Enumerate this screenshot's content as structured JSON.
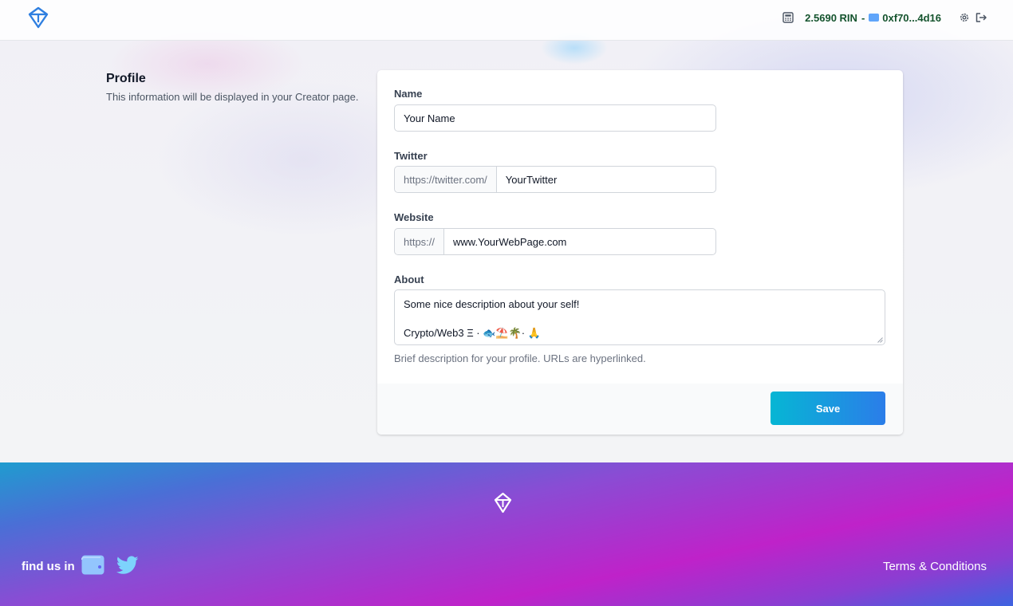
{
  "header": {
    "balance": "2.5690 RIN",
    "separator": "-",
    "address": "0xf70...4d16",
    "icons": [
      "calculator-icon",
      "wallet-chip-icon",
      "gear-icon",
      "logout-icon"
    ]
  },
  "intro": {
    "title": "Profile",
    "description": "This information will be displayed in your Creator page."
  },
  "form": {
    "name": {
      "label": "Name",
      "value": "Your Name"
    },
    "twitter": {
      "label": "Twitter",
      "prefix": "https://twitter.com/",
      "value": "YourTwitter"
    },
    "website": {
      "label": "Website",
      "prefix": "https://",
      "value": "www.YourWebPage.com"
    },
    "about": {
      "label": "About",
      "line1": "Some nice description about your self!",
      "line2": "Crypto/Web3 Ξ · 🐟⛱️🌴· 🙏",
      "hint": "Brief description for your profile. URLs are hyperlinked."
    },
    "save_label": "Save"
  },
  "colors": {
    "accent_start": "#06b6d4",
    "accent_end": "#2b7de9",
    "logo_blue": "#2f7fe0"
  },
  "footer": {
    "find_us": "find us in",
    "terms": "Terms & Conditions"
  }
}
